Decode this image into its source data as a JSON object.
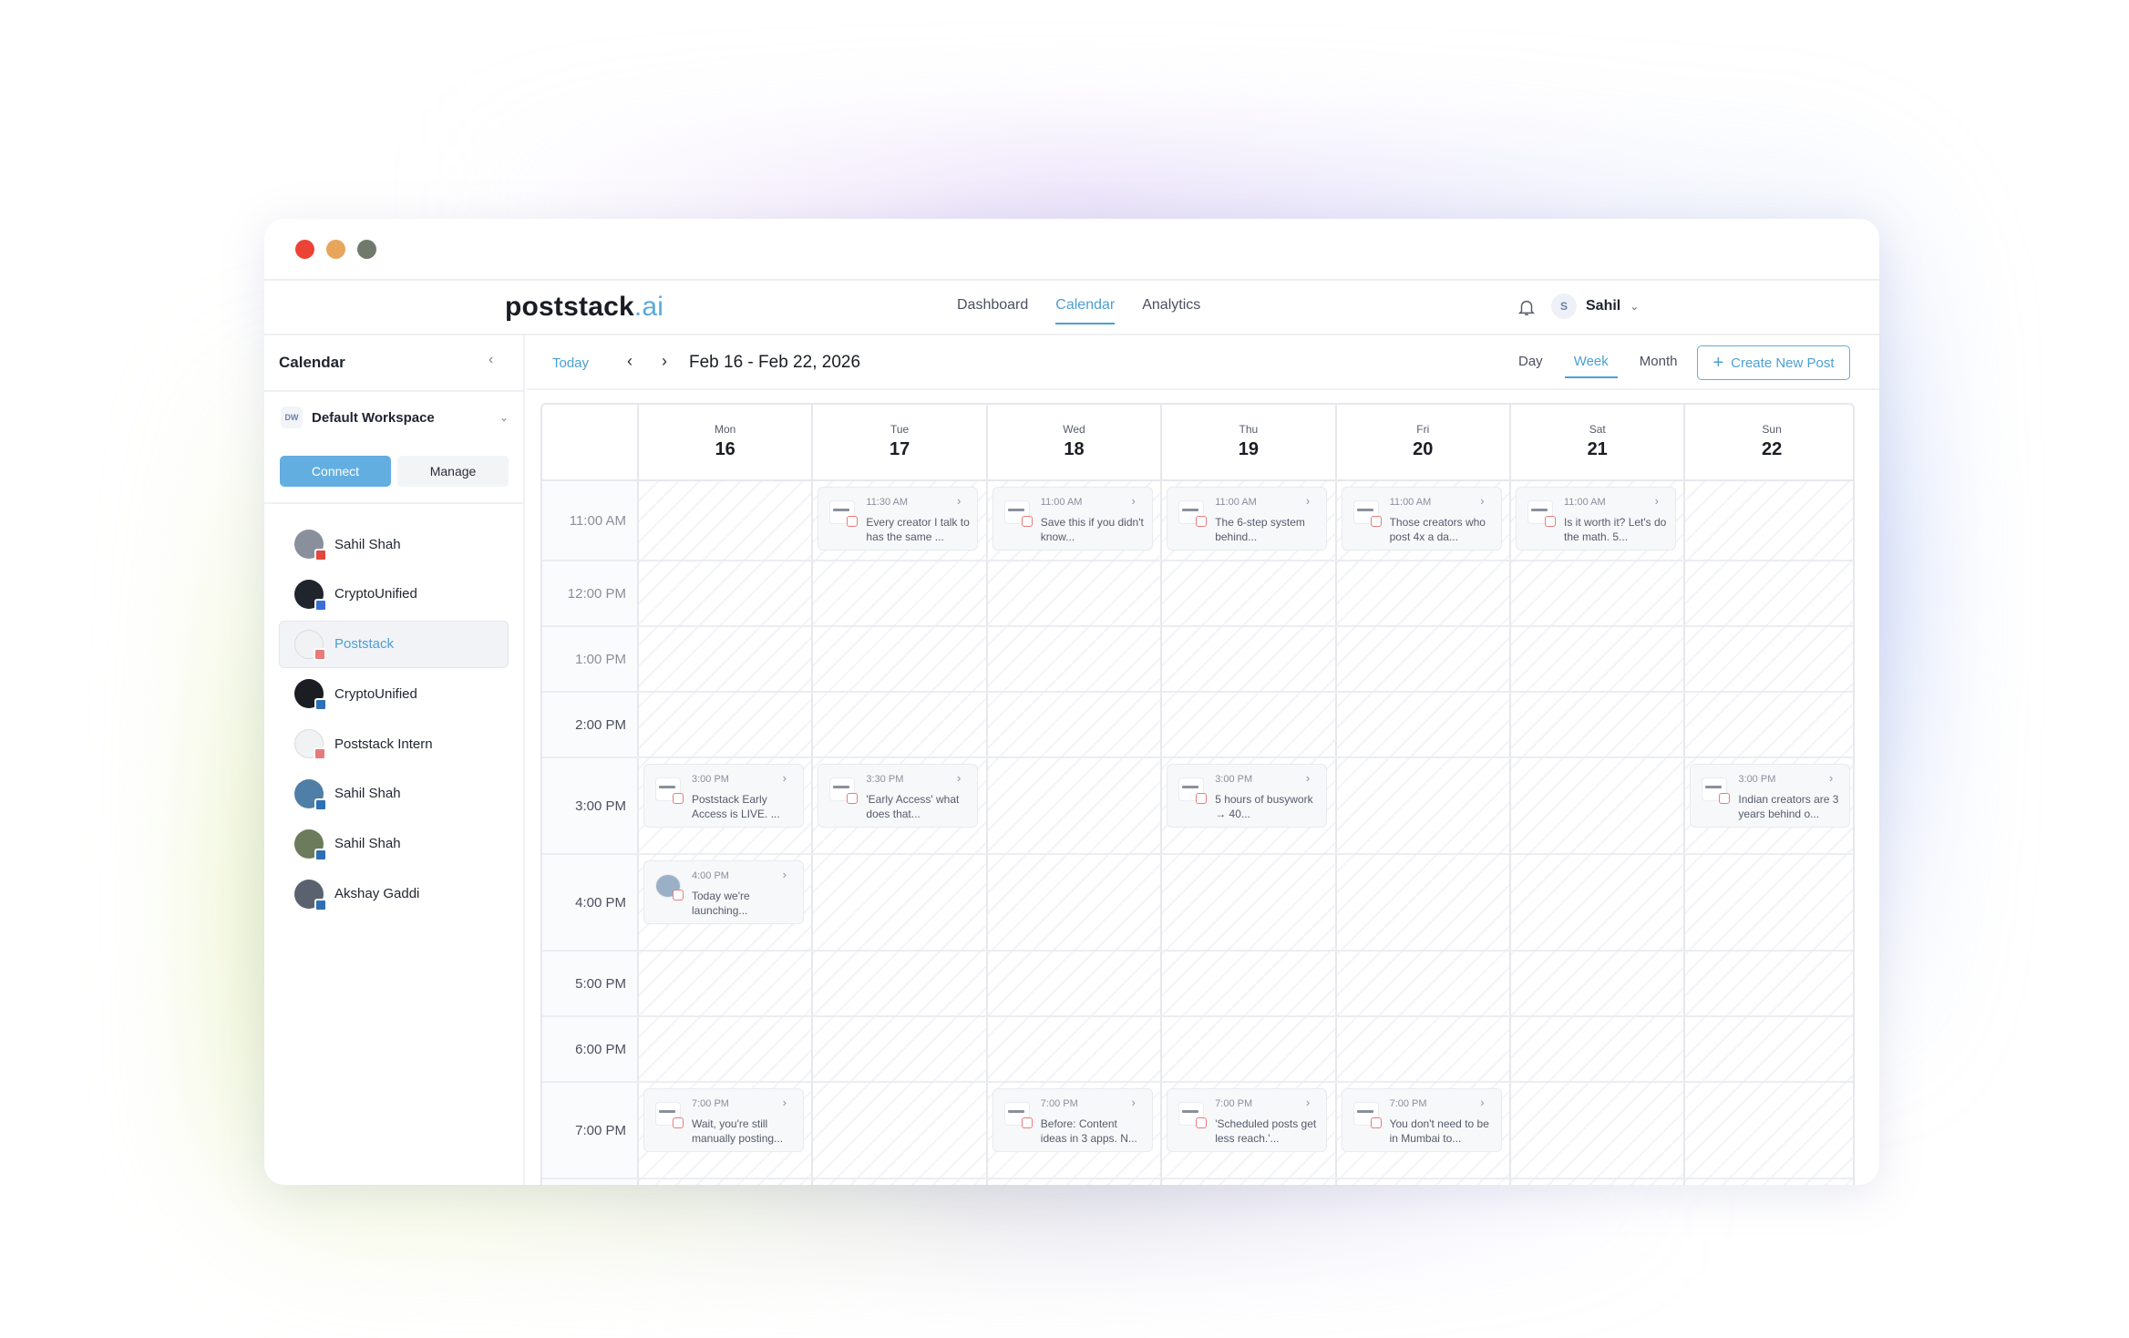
{
  "window": {
    "brand": {
      "name": "poststack",
      "suffix": ".ai"
    },
    "nav": [
      {
        "label": "Dashboard"
      },
      {
        "label": "Calendar"
      },
      {
        "label": "Analytics"
      }
    ],
    "user": {
      "initial": "S",
      "name": "Sahil"
    }
  },
  "sidebar": {
    "title": "Calendar",
    "workspace": {
      "badge": "DW",
      "name": "Default Workspace"
    },
    "connect_label": "Connect",
    "manage_label": "Manage",
    "accounts": [
      {
        "name": "Sahil Shah",
        "platform": "youtube"
      },
      {
        "name": "CryptoUnified",
        "platform": "facebook"
      },
      {
        "name": "Poststack",
        "platform": "instagram",
        "selected": true
      },
      {
        "name": "CryptoUnified",
        "platform": "linkedin"
      },
      {
        "name": "Poststack Intern",
        "platform": "instagram"
      },
      {
        "name": "Sahil Shah",
        "platform": "linkedin"
      },
      {
        "name": "Sahil Shah",
        "platform": "linkedin"
      },
      {
        "name": "Akshay Gaddi",
        "platform": "linkedin"
      }
    ]
  },
  "toolbar": {
    "today_label": "Today",
    "range_label": "Feb 16 - Feb 22, 2026",
    "views": [
      {
        "label": "Day"
      },
      {
        "label": "Week"
      },
      {
        "label": "Month"
      }
    ],
    "create_label": "Create New Post"
  },
  "days": [
    {
      "name": "Mon",
      "date": "16"
    },
    {
      "name": "Tue",
      "date": "17"
    },
    {
      "name": "Wed",
      "date": "18"
    },
    {
      "name": "Thu",
      "date": "19"
    },
    {
      "name": "Fri",
      "date": "20"
    },
    {
      "name": "Sat",
      "date": "21"
    },
    {
      "name": "Sun",
      "date": "22"
    }
  ],
  "times": [
    "11:00 AM",
    "12:00 PM",
    "1:00 PM",
    "2:00 PM",
    "3:00 PM",
    "4:00 PM",
    "5:00 PM",
    "6:00 PM",
    "7:00 PM"
  ],
  "posts": [
    {
      "day": 1,
      "slot": 0,
      "time": "11:30 AM",
      "text": "Every creator I talk to has the same ..."
    },
    {
      "day": 2,
      "slot": 0,
      "time": "11:00 AM",
      "text": "Save this if you didn't know..."
    },
    {
      "day": 3,
      "slot": 0,
      "time": "11:00 AM",
      "text": "The 6-step system behind..."
    },
    {
      "day": 4,
      "slot": 0,
      "time": "11:00 AM",
      "text": "Those creators who post 4x a da..."
    },
    {
      "day": 5,
      "slot": 0,
      "time": "11:00 AM",
      "text": "Is it worth it? Let's do the math. 5..."
    },
    {
      "day": 0,
      "slot": 4,
      "time": "3:00 PM",
      "text": "Poststack Early Access is LIVE. ..."
    },
    {
      "day": 1,
      "slot": 4,
      "time": "3:30 PM",
      "text": "'Early Access' what does that..."
    },
    {
      "day": 3,
      "slot": 4,
      "time": "3:00 PM",
      "text": "5 hours of busywork → 40..."
    },
    {
      "day": 6,
      "slot": 4,
      "time": "3:00 PM",
      "text": "Indian creators are 3 years behind o..."
    },
    {
      "day": 0,
      "slot": 5,
      "time": "4:00 PM",
      "text": "Today we're launching...",
      "avatar": true
    },
    {
      "day": 0,
      "slot": 8,
      "time": "7:00 PM",
      "text": "Wait, you're still manually posting..."
    },
    {
      "day": 2,
      "slot": 8,
      "time": "7:00 PM",
      "text": "Before: Content ideas in 3 apps. N..."
    },
    {
      "day": 3,
      "slot": 8,
      "time": "7:00 PM",
      "text": "'Scheduled posts get less reach.'..."
    },
    {
      "day": 4,
      "slot": 8,
      "time": "7:00 PM",
      "text": "You don't need to be in Mumbai to..."
    }
  ],
  "colors": {
    "accent": "#4b9fd5",
    "button": "#63aee0",
    "instagram": "#e77b7b"
  }
}
